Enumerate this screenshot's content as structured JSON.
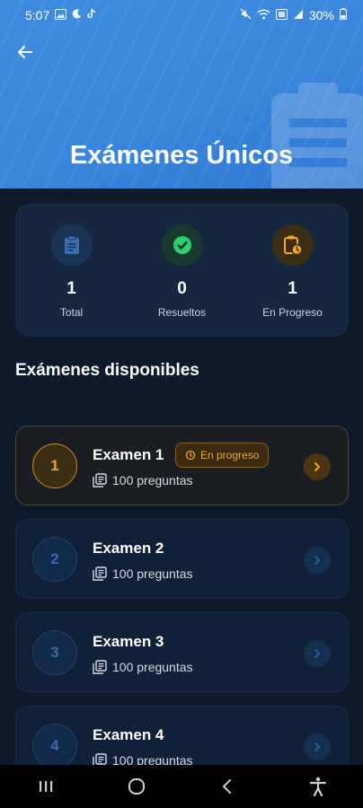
{
  "status_bar": {
    "time": "5:07",
    "battery": "30%"
  },
  "header": {
    "title": "Exámenes Únicos"
  },
  "stats": [
    {
      "value": "1",
      "label": "Total",
      "icon": "clipboard-icon",
      "color": "#3c6fb4"
    },
    {
      "value": "0",
      "label": "Resueltos",
      "icon": "check-circle-icon",
      "color": "#2ecc71"
    },
    {
      "value": "1",
      "label": "En Progreso",
      "icon": "clipboard-clock-icon",
      "color": "#f2a631"
    }
  ],
  "section": {
    "title": "Exámenes disponibles"
  },
  "exams": [
    {
      "number": "1",
      "name": "Examen 1",
      "questions": "100 preguntas",
      "badge": "En progreso",
      "active": true
    },
    {
      "number": "2",
      "name": "Examen 2",
      "questions": "100 preguntas",
      "badge": "",
      "active": false
    },
    {
      "number": "3",
      "name": "Examen 3",
      "questions": "100 preguntas",
      "badge": "",
      "active": false
    },
    {
      "number": "4",
      "name": "Examen 4",
      "questions": "100 preguntas",
      "badge": "",
      "active": false
    }
  ],
  "colors": {
    "header_blue": "#3a86dc",
    "background": "#0c1a2b",
    "accent_orange": "#f2a631",
    "success_green": "#2ecc71"
  }
}
